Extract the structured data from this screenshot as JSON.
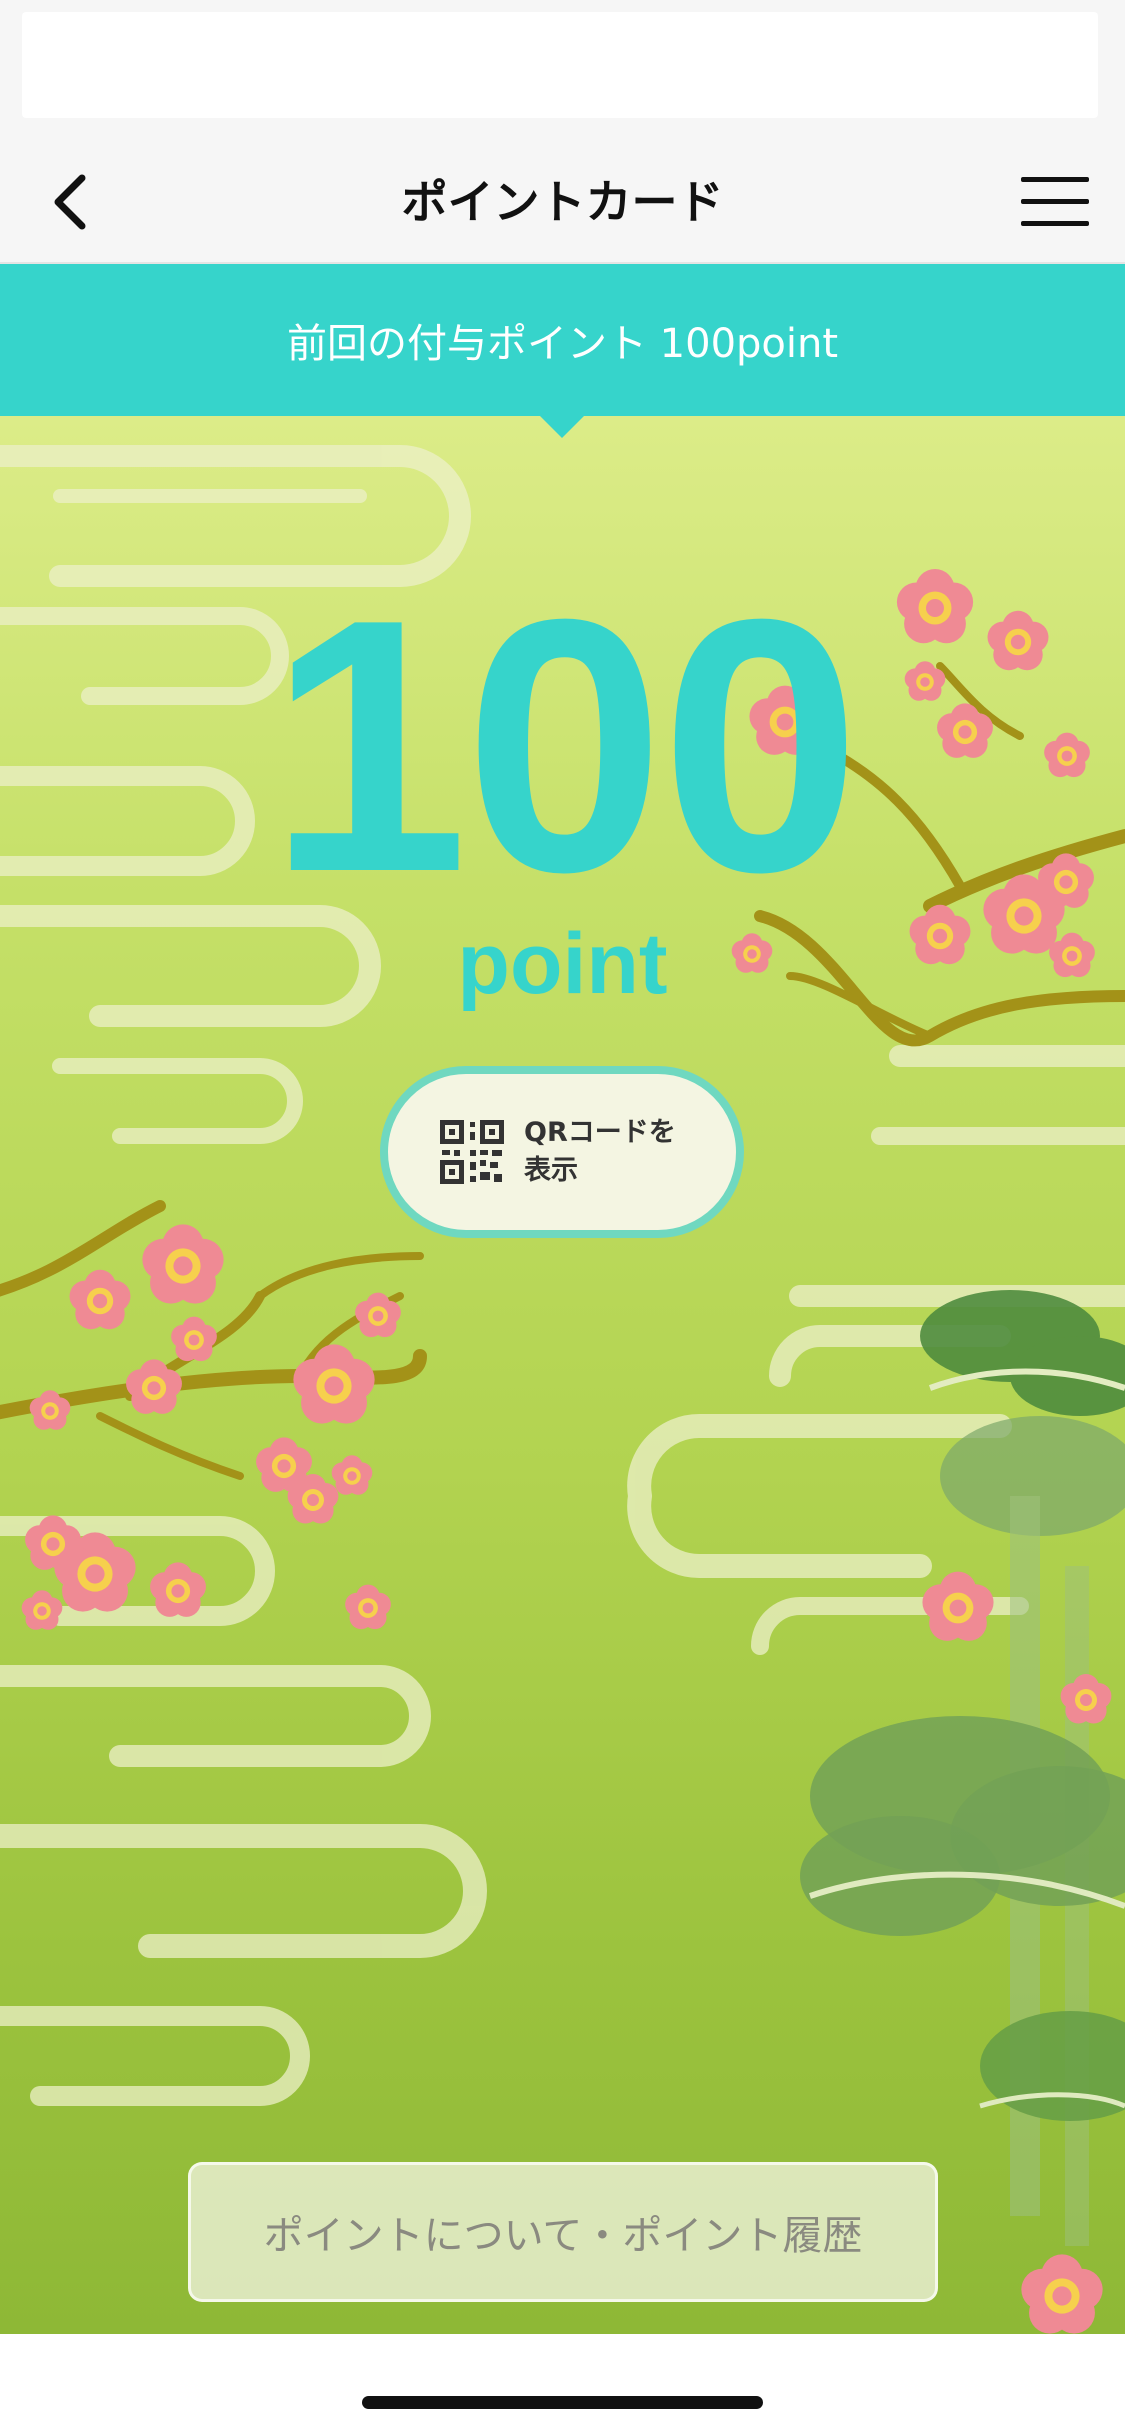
{
  "nav": {
    "title": "ポイントカード",
    "back_icon": "chevron-left-icon",
    "menu_icon": "hamburger-menu-icon"
  },
  "banner": {
    "text": "前回の付与ポイント 100point"
  },
  "points": {
    "value": "100",
    "unit": "point"
  },
  "qr_button": {
    "icon": "qr-code-icon",
    "label_line1": "QRコードを",
    "label_line2": "表示"
  },
  "history_button": {
    "label": "ポイントについて・ポイント履歴"
  },
  "colors": {
    "accent": "#36d4cb",
    "card_top": "#dcec88",
    "card_bottom": "#8eb836",
    "blossom": "#ef8a94",
    "branch": "#a39218",
    "pine": "#5f9a48"
  }
}
